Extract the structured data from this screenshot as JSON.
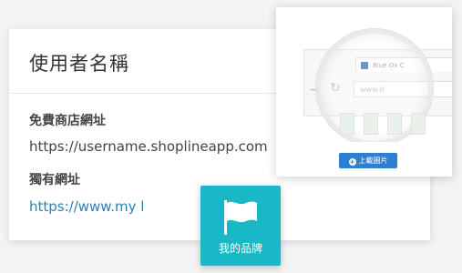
{
  "card": {
    "title": "使用者名稱",
    "free_store_label": "免費商店網址",
    "free_store_url": "https://username.shoplineapp.com",
    "own_domain_label": "獨有網址",
    "own_domain_value": "https://www.my l"
  },
  "upload_card": {
    "browser_tab_title": "Blue Ox C",
    "url_text": "www.b",
    "upload_button_label": "上載圖片",
    "button_color": "#2e7fd0"
  },
  "brand_tile": {
    "label": "我的品牌",
    "icon": "flag-icon",
    "color": "#18b8c6"
  }
}
